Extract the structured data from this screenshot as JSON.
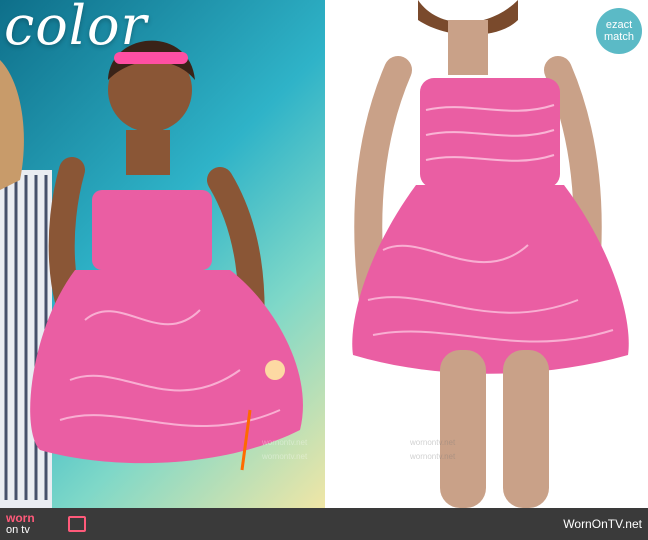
{
  "image": {
    "left_panel": {
      "overlay_text": "color",
      "description_label": "Woman in pink strapless-style tulle mini dress on TV set"
    },
    "right_panel": {
      "description_label": "Model wearing pink tulle mini dress on white background"
    },
    "sticker": {
      "line1": "ezact",
      "line2": "match"
    },
    "watermarks": [
      "wornontv.net",
      "wornontv.net",
      "wornontv.net",
      "wornontv.net"
    ],
    "bottom_bar": {
      "logo_line1": "worn",
      "logo_line2": "on tv",
      "site": "WornOnTV.net"
    },
    "colors": {
      "dress_pink": "#ea5ea3",
      "sticker_teal": "#5bbac6",
      "bar_dark": "#3a3a3a",
      "logo_pink": "#ff5a7a"
    }
  }
}
